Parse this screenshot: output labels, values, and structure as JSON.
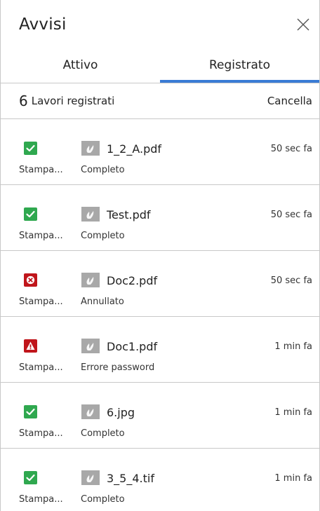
{
  "panel": {
    "title": "Avvisi"
  },
  "tabs": [
    {
      "label": "Attivo",
      "active": false
    },
    {
      "label": "Registrato",
      "active": true
    }
  ],
  "summary": {
    "count": "6",
    "label": "Lavori registrati",
    "clear_label": "Cancella"
  },
  "colors": {
    "accent": "#3a7bd5",
    "success": "#2fa84f",
    "error": "#c0151b"
  },
  "jobs": [
    {
      "status": "success",
      "status_icon": "check-icon",
      "file_icon": "pdf-file-icon",
      "file": "1_2_A.pdf",
      "time": "50 sec fa",
      "kind": "Stampa...",
      "result": "Completo"
    },
    {
      "status": "success",
      "status_icon": "check-icon",
      "file_icon": "pdf-file-icon",
      "file": "Test.pdf",
      "time": "50 sec fa",
      "kind": "Stampa...",
      "result": "Completo"
    },
    {
      "status": "cancelled",
      "status_icon": "cancel-icon",
      "file_icon": "pdf-file-icon",
      "file": "Doc2.pdf",
      "time": "50 sec fa",
      "kind": "Stampa...",
      "result": "Annullato"
    },
    {
      "status": "warning",
      "status_icon": "warning-icon",
      "file_icon": "pdf-file-icon",
      "file": "Doc1.pdf",
      "time": "1 min fa",
      "kind": "Stampa...",
      "result": "Errore password"
    },
    {
      "status": "success",
      "status_icon": "check-icon",
      "file_icon": "image-file-icon",
      "file": "6.jpg",
      "time": "1 min fa",
      "kind": "Stampa...",
      "result": "Completo"
    },
    {
      "status": "success",
      "status_icon": "check-icon",
      "file_icon": "image-file-icon",
      "file": "3_5_4.tif",
      "time": "1 min fa",
      "kind": "Stampa...",
      "result": "Completo"
    }
  ]
}
